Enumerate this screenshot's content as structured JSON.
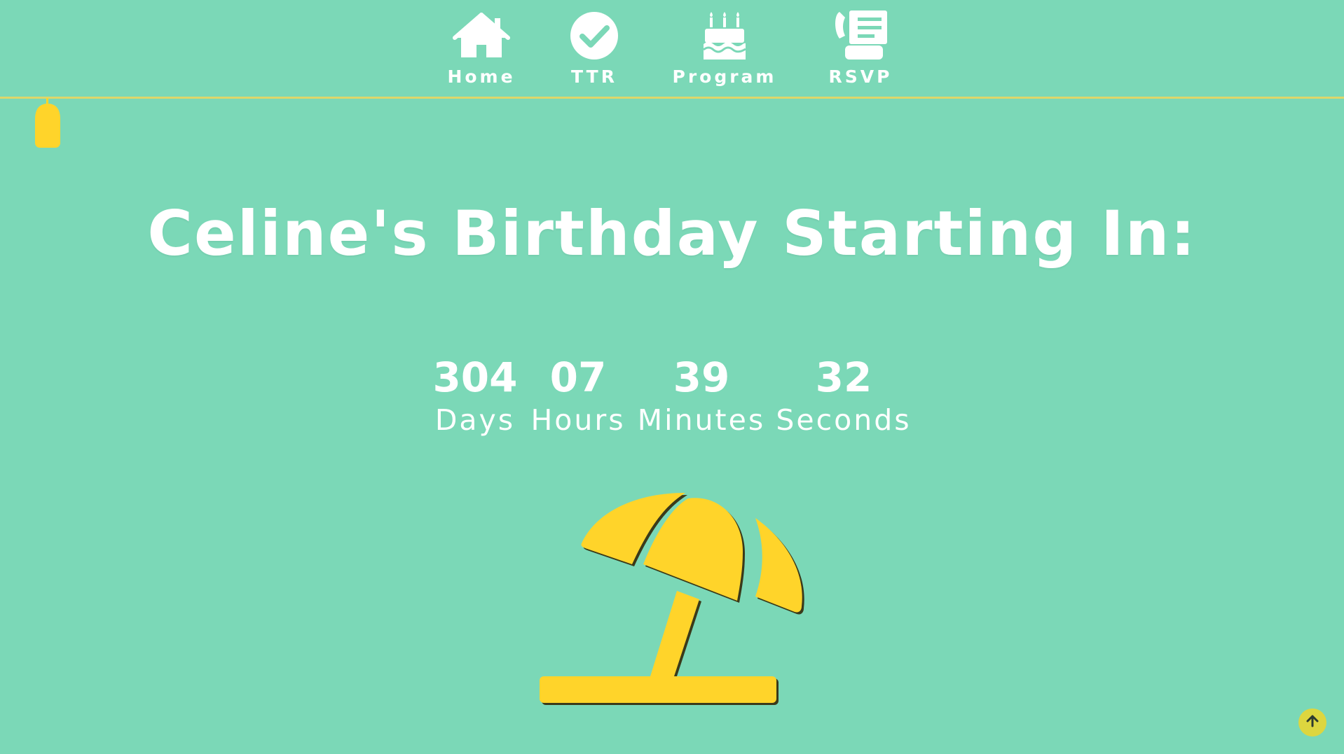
{
  "nav": {
    "items": [
      {
        "label": "Home",
        "icon": "home-icon"
      },
      {
        "label": "TTR",
        "icon": "check-circle-icon"
      },
      {
        "label": "Program",
        "icon": "birthday-cake-icon"
      },
      {
        "label": "RSVP",
        "icon": "fax-phone-icon"
      }
    ]
  },
  "hero": {
    "title": "Celine's Birthday Starting In:"
  },
  "countdown": {
    "days": {
      "value": "304",
      "label": "Days"
    },
    "hours": {
      "value": "07",
      "label": "Hours"
    },
    "minutes": {
      "value": "39",
      "label": "Minutes"
    },
    "seconds": {
      "value": "32",
      "label": "Seconds"
    }
  },
  "decor": {
    "lamp_icon": "hanging-lamp-icon",
    "umbrella_icon": "beach-umbrella-icon"
  },
  "scroll_top": {
    "icon": "arrow-up-icon"
  },
  "colors": {
    "background": "#7bd8b7",
    "accent_yellow": "#ffd42a",
    "nav_line": "#ddd66b",
    "text": "#ffffff"
  }
}
